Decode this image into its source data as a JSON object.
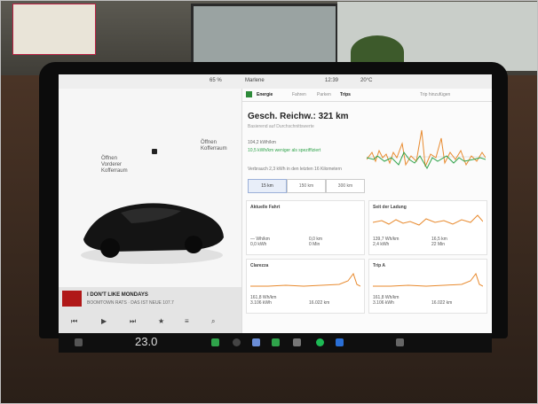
{
  "status": {
    "battery": "65 %",
    "user": "Marlene",
    "time": "12:39",
    "outside_temp": "20°C"
  },
  "car": {
    "frunk_label": "Öffnen\nVorderer\nKofferraum",
    "trunk_label": "Öffnen\nKofferraum"
  },
  "media": {
    "track": "I DON'T LIKE MONDAYS",
    "station": "BOOMTOWN RATS · DAS IST NEUE 107.7",
    "icons": [
      "prev-icon",
      "play-icon",
      "next-icon",
      "favorite-icon",
      "equalizer-icon",
      "search-icon"
    ]
  },
  "energy": {
    "tabs": [
      "Energie",
      "Fahren",
      "Parken",
      "Trips"
    ],
    "active_tab": "Trips",
    "header_link": "Trip hinzufügen",
    "range_title": "Gesch. Reichw.: 321 km",
    "range_sub": "Basierend auf Durchschnittswerte",
    "kwh": "104,2 kWh/km",
    "savings": "10,5 kWh/km weniger als speziffiziert",
    "consumption": "Verbrauch 2,3 kWh in den letzten 16 Kilometern",
    "segments": [
      "15 km",
      "150 km",
      "300 km"
    ],
    "selected_segment": "15 km",
    "cards": [
      {
        "title": "Aktuelle Fahrt",
        "v1": "— Wh/km\n0,0 kWh",
        "v2": "0,0 km\n0 Min"
      },
      {
        "title": "Seit der Ladung",
        "v1": "139,7 Wh/km\n2,4 kWh",
        "v2": "16,5 km\n22 Min"
      },
      {
        "title": "Clarezza",
        "v1": "161,8 Wh/km\n3.106 kWh",
        "v2": "16.022 km"
      },
      {
        "title": "Trip A",
        "v1": "161,8 Wh/km\n3.106 kWh",
        "v2": "16.022 km"
      }
    ]
  },
  "taskbar": {
    "cabin_temp": "23.0",
    "icons": [
      "car-icon",
      "phone-icon",
      "camera-icon",
      "apps-icon",
      "energy-icon",
      "dots-icon",
      "spotify-icon",
      "bluetooth-icon",
      "volume-icon"
    ]
  }
}
